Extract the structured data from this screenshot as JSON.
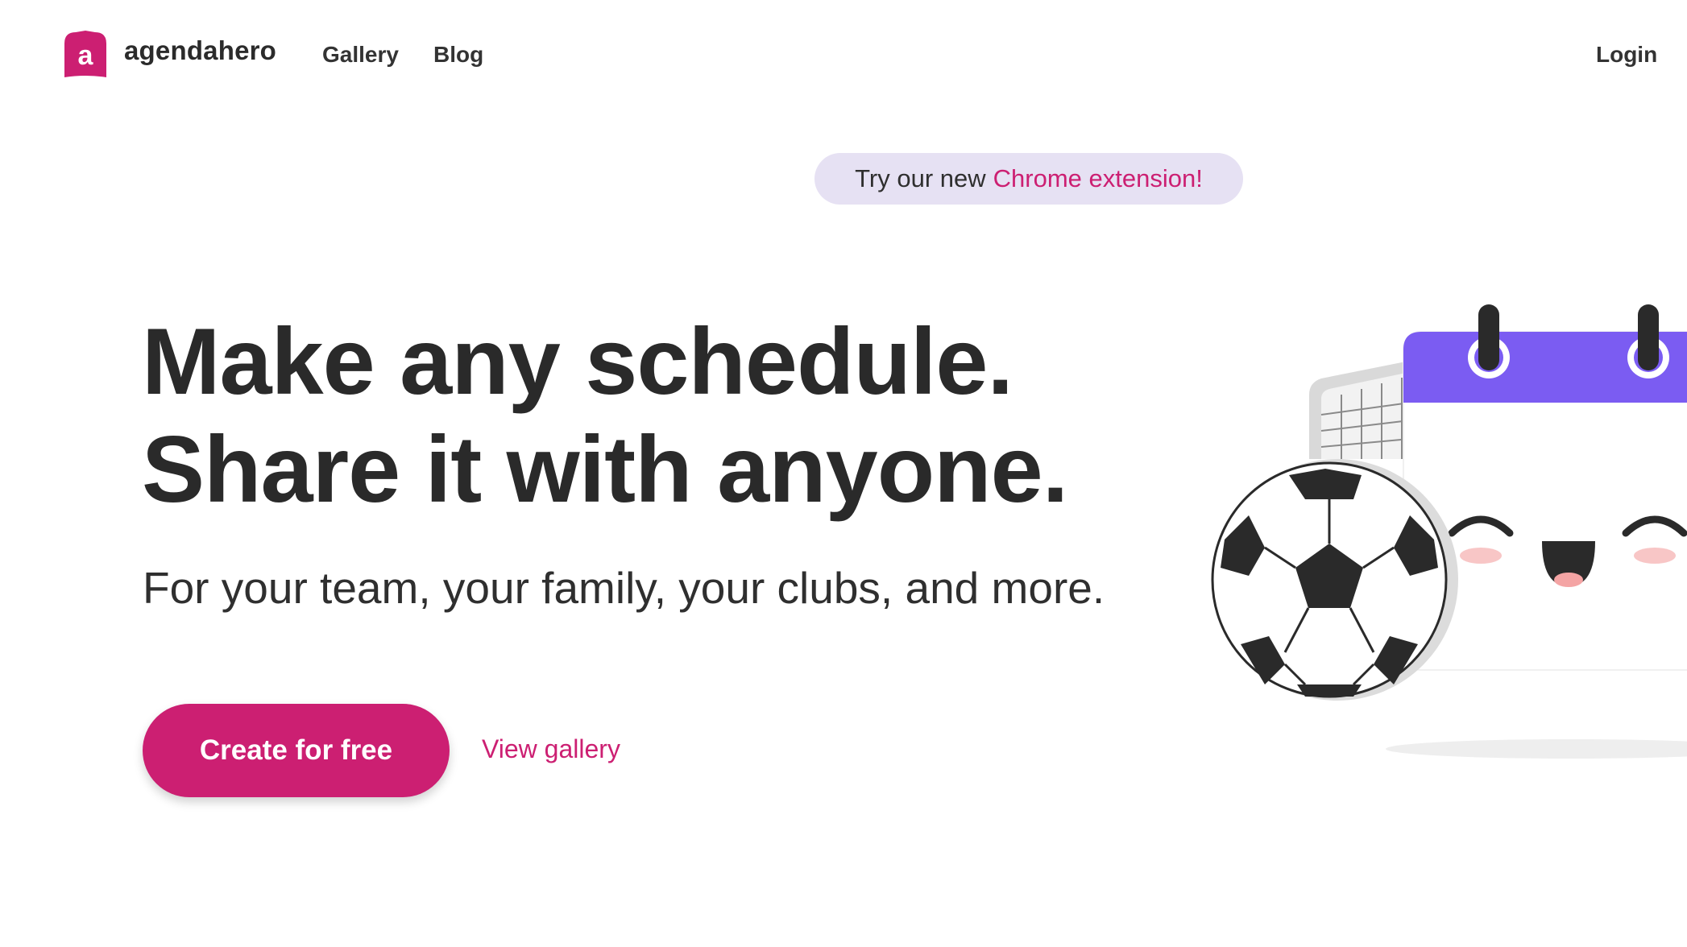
{
  "header": {
    "logo_letter": "a",
    "brand": "agendahero",
    "nav": [
      {
        "label": "Gallery"
      },
      {
        "label": "Blog"
      }
    ],
    "login_label": "Login"
  },
  "announcement": {
    "prefix": "Try our new",
    "link_text": "Chrome extension!"
  },
  "hero": {
    "headline_line1": "Make any schedule.",
    "headline_line2": "Share it with anyone.",
    "subhead": "For your team, your family, your clubs, and more.",
    "primary_cta": "Create for free",
    "secondary_cta": "View gallery"
  },
  "illustration": {
    "icons": [
      "soccer-ball-icon",
      "soccer-goal-icon",
      "calendar-mascot-icon"
    ]
  },
  "colors": {
    "brand_pink": "#cc1f72",
    "pill_bg": "#e6e1f3",
    "calendar_header": "#7b5cf2",
    "text_dark": "#2a2a2a"
  }
}
